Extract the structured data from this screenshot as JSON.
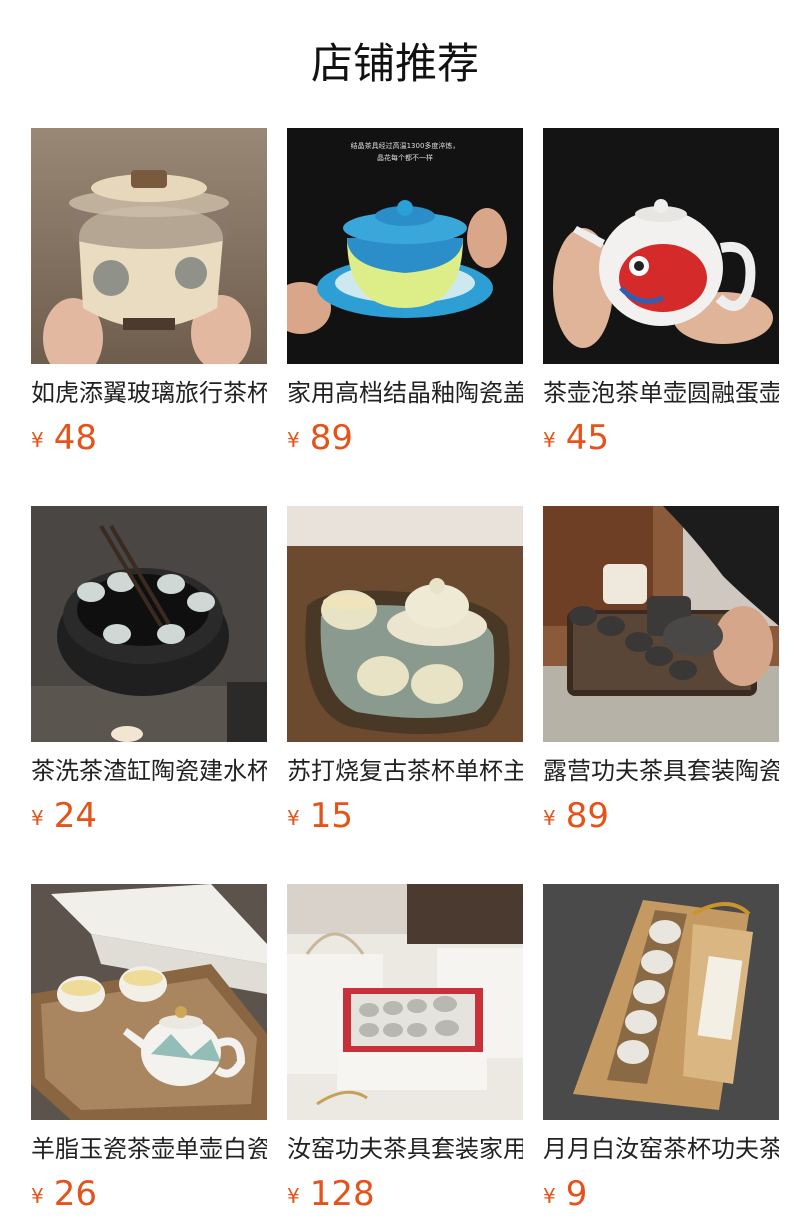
{
  "page": {
    "title": "店铺推荐"
  },
  "currency_symbol": "¥",
  "products": [
    {
      "name": "如虎添翼玻璃旅行茶杯",
      "price": "48",
      "image_icon": "gaiwan-cup-photo",
      "image_text": ""
    },
    {
      "name": "家用高档结晶釉陶瓷盖碗",
      "price": "89",
      "image_icon": "blue-gaiwan-photo",
      "image_text": "结晶茶具经过高温1300多度淬炼，晶花每个都不一样"
    },
    {
      "name": "茶壶泡茶单壶圆融蛋壶",
      "price": "45",
      "image_icon": "koi-teapot-photo",
      "image_text": ""
    },
    {
      "name": "茶洗茶渣缸陶瓷建水杯洗",
      "price": "24",
      "image_icon": "tea-washer-bowl-photo",
      "image_text": ""
    },
    {
      "name": "苏打烧复古茶杯单杯主人杯",
      "price": "15",
      "image_icon": "vintage-teacups-photo",
      "image_text": ""
    },
    {
      "name": "露营功夫茶具套装陶瓷",
      "price": "89",
      "image_icon": "camping-tea-set-photo",
      "image_text": ""
    },
    {
      "name": "羊脂玉瓷茶壶单壶白瓷",
      "price": "26",
      "image_icon": "white-teapot-photo",
      "image_text": ""
    },
    {
      "name": "汝窑功夫茶具套装家用",
      "price": "128",
      "image_icon": "ru-kiln-gift-set-photo",
      "image_text": ""
    },
    {
      "name": "月月白汝窑茶杯功夫茶杯",
      "price": "9",
      "image_icon": "boxed-teacups-photo",
      "image_text": ""
    }
  ]
}
